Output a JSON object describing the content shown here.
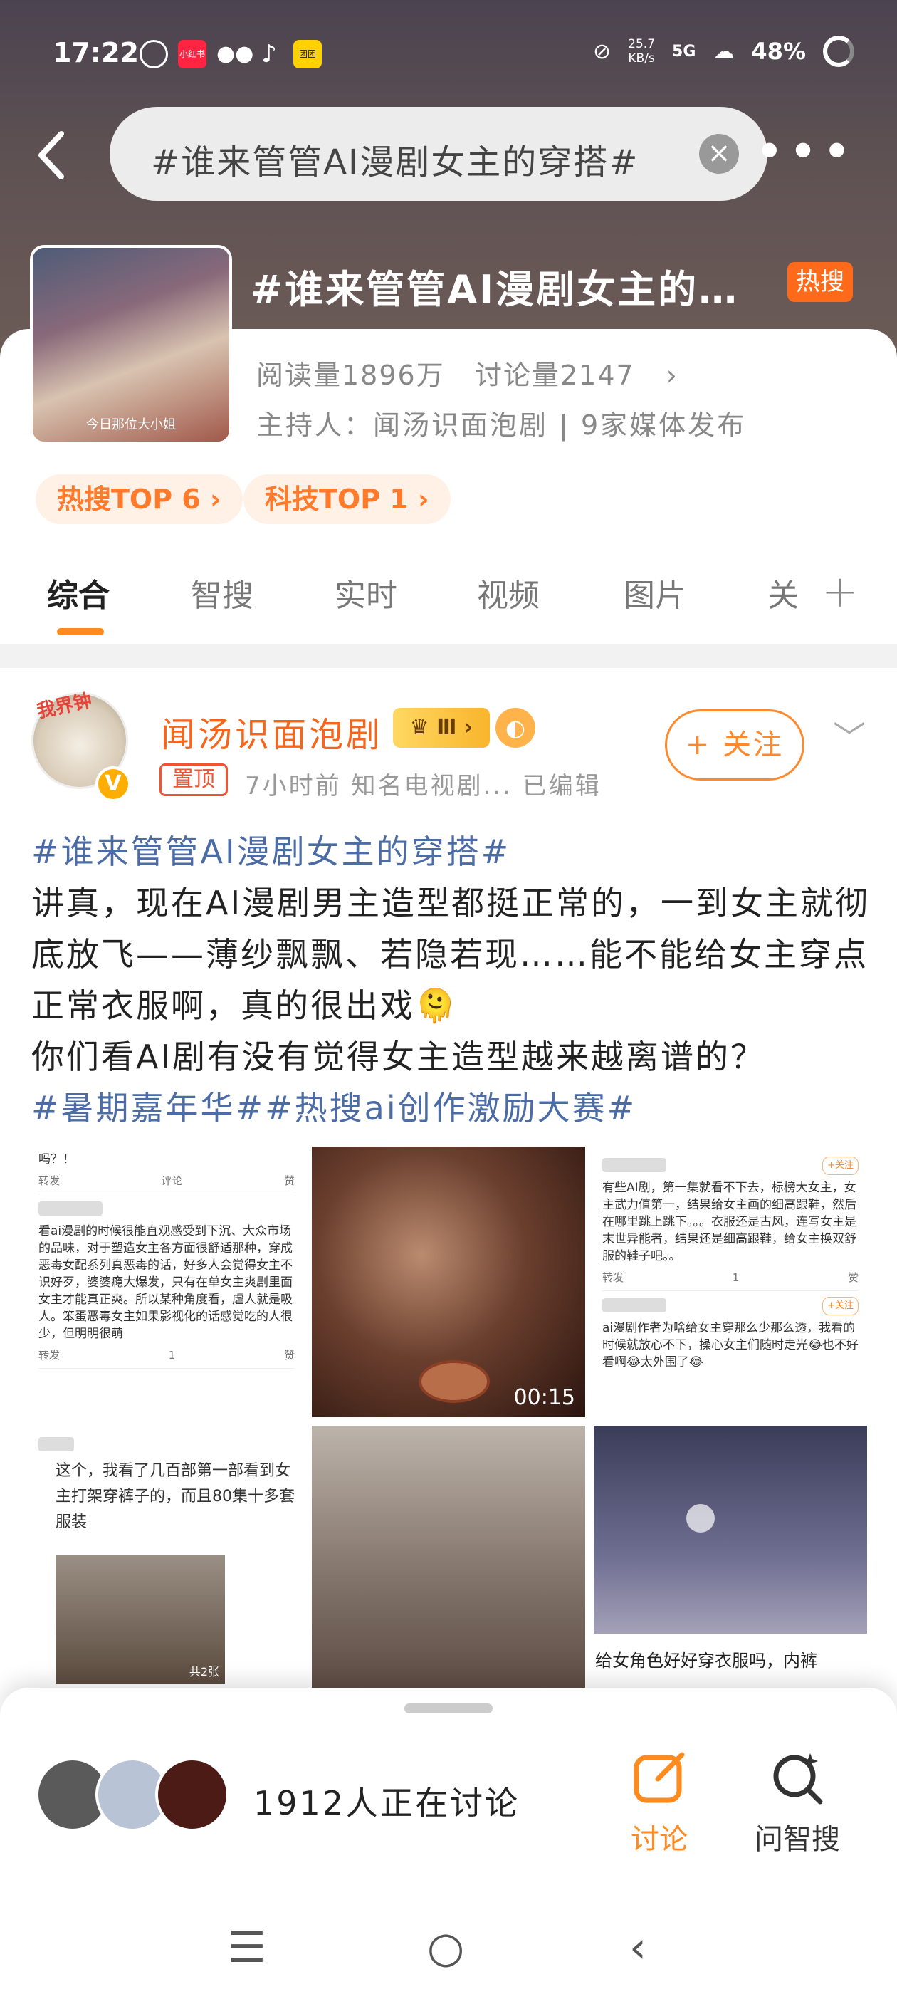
{
  "status_bar": {
    "time": "17:22",
    "speed_value": "25.7",
    "speed_unit": "KB/s",
    "network": "5G",
    "battery": "48%",
    "app_icons": [
      "weibo-icon",
      "xiaohongshu-icon",
      "wechat-icon",
      "tiktok-icon",
      "meituan-icon"
    ],
    "app_labels": [
      "",
      "小红书",
      "",
      "",
      "团团"
    ]
  },
  "search": {
    "query": "#谁来管管AI漫剧女主的穿搭#"
  },
  "topic": {
    "title": "#谁来管管AI漫剧女主的…",
    "hot_badge": "热搜",
    "reads": "阅读量1896万",
    "discussions": "讨论量2147",
    "host": "主持人：闻汤识面泡剧 | 9家媒体发布",
    "cover_caption": "今日那位大小姐",
    "chips": [
      "热搜TOP 6 ›",
      "科技TOP 1 ›"
    ]
  },
  "tabs": [
    "综合",
    "智搜",
    "实时",
    "视频",
    "图片",
    "关"
  ],
  "post": {
    "username": "闻汤识面泡剧",
    "level": "Ⅲ",
    "avatar_tag": "我界钟",
    "pin_label": "置顶",
    "meta": "7小时前  知名电视剧...  已编辑",
    "follow_label": "+ 关注",
    "hashtag": "#谁来管管AI漫剧女主的穿搭#",
    "body1": "讲真，现在AI漫剧男主造型都挺正常的，一到女主就彻底放飞——薄纱飘飘、若隐若现……能不能给女主穿点正常衣服啊，真的很出戏🫠",
    "body2": "你们看AI剧有没有觉得女主造型越来越离谱的？",
    "tags": "#暑期嘉年华##热搜ai创作激励大赛#"
  },
  "grid": {
    "shot1_top": "吗？！",
    "shot1_actions": [
      "转发",
      "评论",
      "赞"
    ],
    "shot1_text": "看ai漫剧的时候很能直观感受到下沉、大众市场的品味，对于塑造女主各方面很舒适那种，穿成恶毒女配系列真恶毒的话，好多人会觉得女主不识好歹，婆婆瘾大爆发，只有在单女主爽剧里面女主才能真正爽。所以某种角度看，虐人就是吸人。笨蛋恶毒女主如果影视化的话感觉吃的人很少，但明明很萌",
    "shot1_actions2": [
      "转发",
      "1",
      "赞"
    ],
    "video_duration": "00:15",
    "shot3_follow": "+关注",
    "shot3_text": "有些AI剧，第一集就看不下去，标榜大女主，女主武力值第一，结果给女主画的细高跟鞋，然后在哪里跳上跳下。。。衣服还是古风，连写女主是末世异能者，结果还是细高跟鞋，给女主换双舒服的鞋子吧。。",
    "shot3_actions": [
      "转发",
      "1",
      "赞"
    ],
    "shot3_text2": "ai漫剧作者为啥给女主穿那么少那么透，我看的时候就放心不下，操心女主们随时走光😂也不好看啊😂太外围了😂",
    "shot4_text": "这个，我看了几百部第一部看到女主打架穿裤子的，而且80集十多套服装",
    "shot4_count": "共2张",
    "img3_caption": "给女角色好好穿衣服吗，内裤"
  },
  "bottom": {
    "discuss_count": "1912人正在讨论",
    "discuss_label": "讨论",
    "ask_label": "问智搜"
  },
  "colors": {
    "accent": "#ff8a1e",
    "hashtag": "#4c6ca6",
    "hot": "#ff6a1a"
  }
}
